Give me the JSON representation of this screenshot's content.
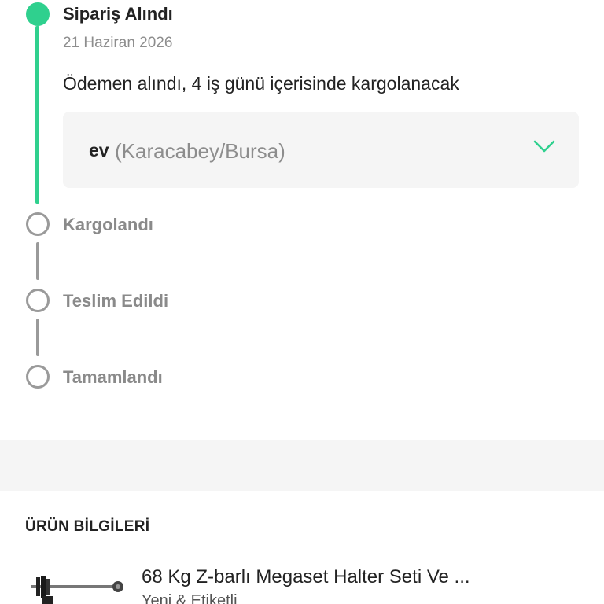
{
  "timeline": {
    "steps": [
      {
        "label": "Sipariş Alındı",
        "state": "done"
      },
      {
        "label": "Kargolandı",
        "state": "pending"
      },
      {
        "label": "Teslim Edildi",
        "state": "pending"
      },
      {
        "label": "Tamamlandı",
        "state": "pending"
      }
    ],
    "current": {
      "date": "21 Haziran 2026",
      "description": "Ödemen alındı, 4 iş günü içerisinde kargolanacak"
    },
    "address": {
      "name": "ev",
      "location": "(Karacabey/Bursa)"
    }
  },
  "product_section": {
    "title": "ÜRÜN BİLGİLERİ",
    "product": {
      "name": "68 Kg Z-barlı Megaset Halter Seti Ve ...",
      "condition": "Yeni & Etiketli"
    }
  },
  "colors": {
    "accent": "#2fd08e",
    "pending": "#9a9a9a",
    "band": "#f5f5f5"
  },
  "icons": {
    "expand": "chevron-down-icon",
    "step_done": "filled-circle-icon",
    "step_pending": "empty-circle-icon"
  }
}
